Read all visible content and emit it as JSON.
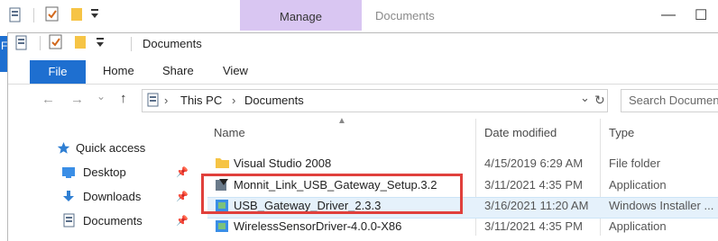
{
  "outer": {
    "context_tab": "Manage",
    "title": "Documents",
    "minimize": "—",
    "maximize": "☐",
    "file_letter": "F"
  },
  "inner": {
    "title": "Documents",
    "ribbon": {
      "file": "File",
      "tabs": [
        "Home",
        "Share",
        "View"
      ]
    },
    "address": {
      "back": "←",
      "forward": "→",
      "recent": "⌄",
      "up": "↑",
      "crumbs": [
        "This PC",
        "Documents"
      ],
      "separator": "›",
      "dropdown": "⌄",
      "refresh": "↻"
    },
    "search_placeholder": "Search Documents",
    "columns": {
      "name": "Name",
      "date": "Date modified",
      "type": "Type"
    },
    "nav": [
      {
        "label": "Quick access",
        "icon": "star-icon"
      },
      {
        "label": "Desktop",
        "icon": "desktop-icon",
        "pinned": true
      },
      {
        "label": "Downloads",
        "icon": "download-icon",
        "pinned": true
      },
      {
        "label": "Documents",
        "icon": "document-icon",
        "pinned": true
      }
    ],
    "files": [
      {
        "name": "Visual Studio 2008",
        "date": "4/15/2019 6:29 AM",
        "type": "File folder",
        "icon": "folder-icon"
      },
      {
        "name": "Monnit_Link_USB_Gateway_Setup.3.2",
        "date": "3/11/2021 4:35 PM",
        "type": "Application",
        "icon": "setup-app-icon"
      },
      {
        "name": "USB_Gateway_Driver_2.3.3",
        "date": "3/16/2021 11:20 AM",
        "type": "Windows Installer ...",
        "icon": "installer-icon"
      },
      {
        "name": "WirelessSensorDriver-4.0.0-X86",
        "date": "3/11/2021 4:35 PM",
        "type": "Application",
        "icon": "installer-icon"
      }
    ],
    "pin_glyph": "📌",
    "colors": {
      "accent": "#1e6fd0",
      "highlight": "#e0403c",
      "manage_tab": "#d9c6f2",
      "selection": "#e5f1fb"
    }
  }
}
